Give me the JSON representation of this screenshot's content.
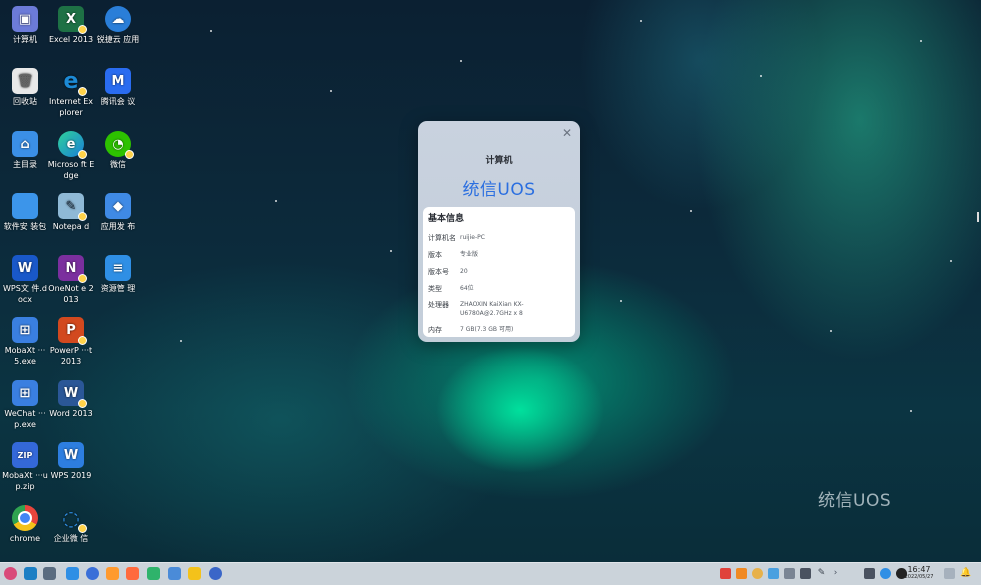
{
  "desktop": {
    "icons": [
      {
        "label": "计算机",
        "icon": "computer-icon",
        "color": "#6c7bd8"
      },
      {
        "label": "Excel 2013",
        "icon": "excel-icon",
        "color": "#1e7145"
      },
      {
        "label": "锐捷云 应用",
        "icon": "ruijie-cloud-icon",
        "color": "#2a7ed8"
      },
      {
        "label": "回收站",
        "icon": "trash-icon",
        "color": "#e8e8e8"
      },
      {
        "label": "Internet Explorer",
        "icon": "ie-icon",
        "color": "#1c8ad6"
      },
      {
        "label": "腾讯会 议",
        "icon": "tencent-meeting-icon",
        "color": "#2a6cf0"
      },
      {
        "label": "主目录",
        "icon": "home-folder-icon",
        "color": "#3b8fe6"
      },
      {
        "label": "Microso ft Edge",
        "icon": "edge-icon",
        "color": "#1a9fd7"
      },
      {
        "label": "微信",
        "icon": "wechat-icon",
        "color": "#2dc100"
      },
      {
        "label": "软件安 装包",
        "icon": "folder-icon",
        "color": "#3c95ea"
      },
      {
        "label": "Notepa d",
        "icon": "notepad-icon",
        "color": "#8fb9d6"
      },
      {
        "label": "应用发 布",
        "icon": "app-publish-icon",
        "color": "#3f8ae5"
      },
      {
        "label": "WPS文 件.docx",
        "icon": "wps-doc-icon",
        "color": "#1958c9"
      },
      {
        "label": "OneNot e 2013",
        "icon": "onenote-icon",
        "color": "#7b2f9e"
      },
      {
        "label": "资源管 理",
        "icon": "file-manager-icon",
        "color": "#2f8fe5"
      },
      {
        "label": "MobaXt ···5.exe",
        "icon": "exe-icon",
        "color": "#3a7fe0"
      },
      {
        "label": "PowerP ···t 2013",
        "icon": "powerpoint-icon",
        "color": "#d2491f"
      },
      {
        "label": "WeChat ···p.exe",
        "icon": "exe-icon",
        "color": "#3a7fe0"
      },
      {
        "label": "Word 2013",
        "icon": "word-icon",
        "color": "#2b5797"
      },
      {
        "label": "MobaXt ···up.zip",
        "icon": "zip-icon",
        "color": "#3468d8"
      },
      {
        "label": "WPS 2019",
        "icon": "wps-icon",
        "color": "#2d7ee0"
      },
      {
        "label": "chrome",
        "icon": "chrome-icon",
        "color": "#e8453c"
      },
      {
        "label": "企业微 信",
        "icon": "wecom-icon",
        "color": "#2f8fe8"
      }
    ],
    "watermark": "统信UOS"
  },
  "about_dialog": {
    "title": "计算机",
    "logo_text": "统信UOS",
    "section_title": "基本信息",
    "rows": [
      {
        "key": "计算机名",
        "value": "ruijie-PC"
      },
      {
        "key": "版本",
        "value": "专业版"
      },
      {
        "key": "版本号",
        "value": "20"
      },
      {
        "key": "类型",
        "value": "64位"
      },
      {
        "key": "处理器",
        "value": "ZHAOXIN KaiXian KX-U6780A@2.7GHz x 8"
      },
      {
        "key": "内存",
        "value": "7 GB(7.3 GB 可用)"
      }
    ]
  },
  "taskbar": {
    "time": "16:47",
    "date": "2022/05/27",
    "apps": [
      {
        "icon": "launcher-icon",
        "color": "#d94b7a"
      },
      {
        "icon": "show-desktop-icon",
        "color": "#1b7fc4"
      },
      {
        "icon": "multitask-icon",
        "color": "#5a6c80"
      },
      {
        "icon": "file-manager-icon",
        "color": "#2f8fe5"
      },
      {
        "icon": "browser-icon",
        "color": "#3a6fd8"
      },
      {
        "icon": "app-store-icon",
        "color": "#ff9a2e"
      },
      {
        "icon": "music-icon",
        "color": "#ff6a3d"
      },
      {
        "icon": "image-viewer-icon",
        "color": "#2fb36b"
      },
      {
        "icon": "document-viewer-icon",
        "color": "#4a8bd8"
      },
      {
        "icon": "notes-icon",
        "color": "#f4c21a"
      },
      {
        "icon": "settings-icon",
        "color": "#3a66c8"
      }
    ],
    "tray": [
      {
        "icon": "record-icon",
        "color": "#e0423b"
      },
      {
        "icon": "upload-icon",
        "color": "#f08a24"
      },
      {
        "icon": "weather-icon",
        "color": "#e7b14a"
      },
      {
        "icon": "network-icon",
        "color": "#4aa0e0"
      },
      {
        "icon": "keyboard-icon",
        "color": "#7a8594"
      },
      {
        "icon": "volume-icon",
        "color": "#4a5260"
      },
      {
        "icon": "pen-icon",
        "color": "#3a424d"
      },
      {
        "icon": "expand-tray-icon",
        "color": "#4a5260"
      },
      {
        "icon": "screen-icon",
        "color": "#4a5260"
      },
      {
        "icon": "assistant-icon",
        "color": "#2f8fe5"
      },
      {
        "icon": "clock-widget-icon",
        "color": "#222"
      },
      {
        "icon": "trash-icon",
        "color": "#a6b1bd"
      },
      {
        "icon": "notification-icon",
        "color": "#3a424d"
      }
    ]
  }
}
